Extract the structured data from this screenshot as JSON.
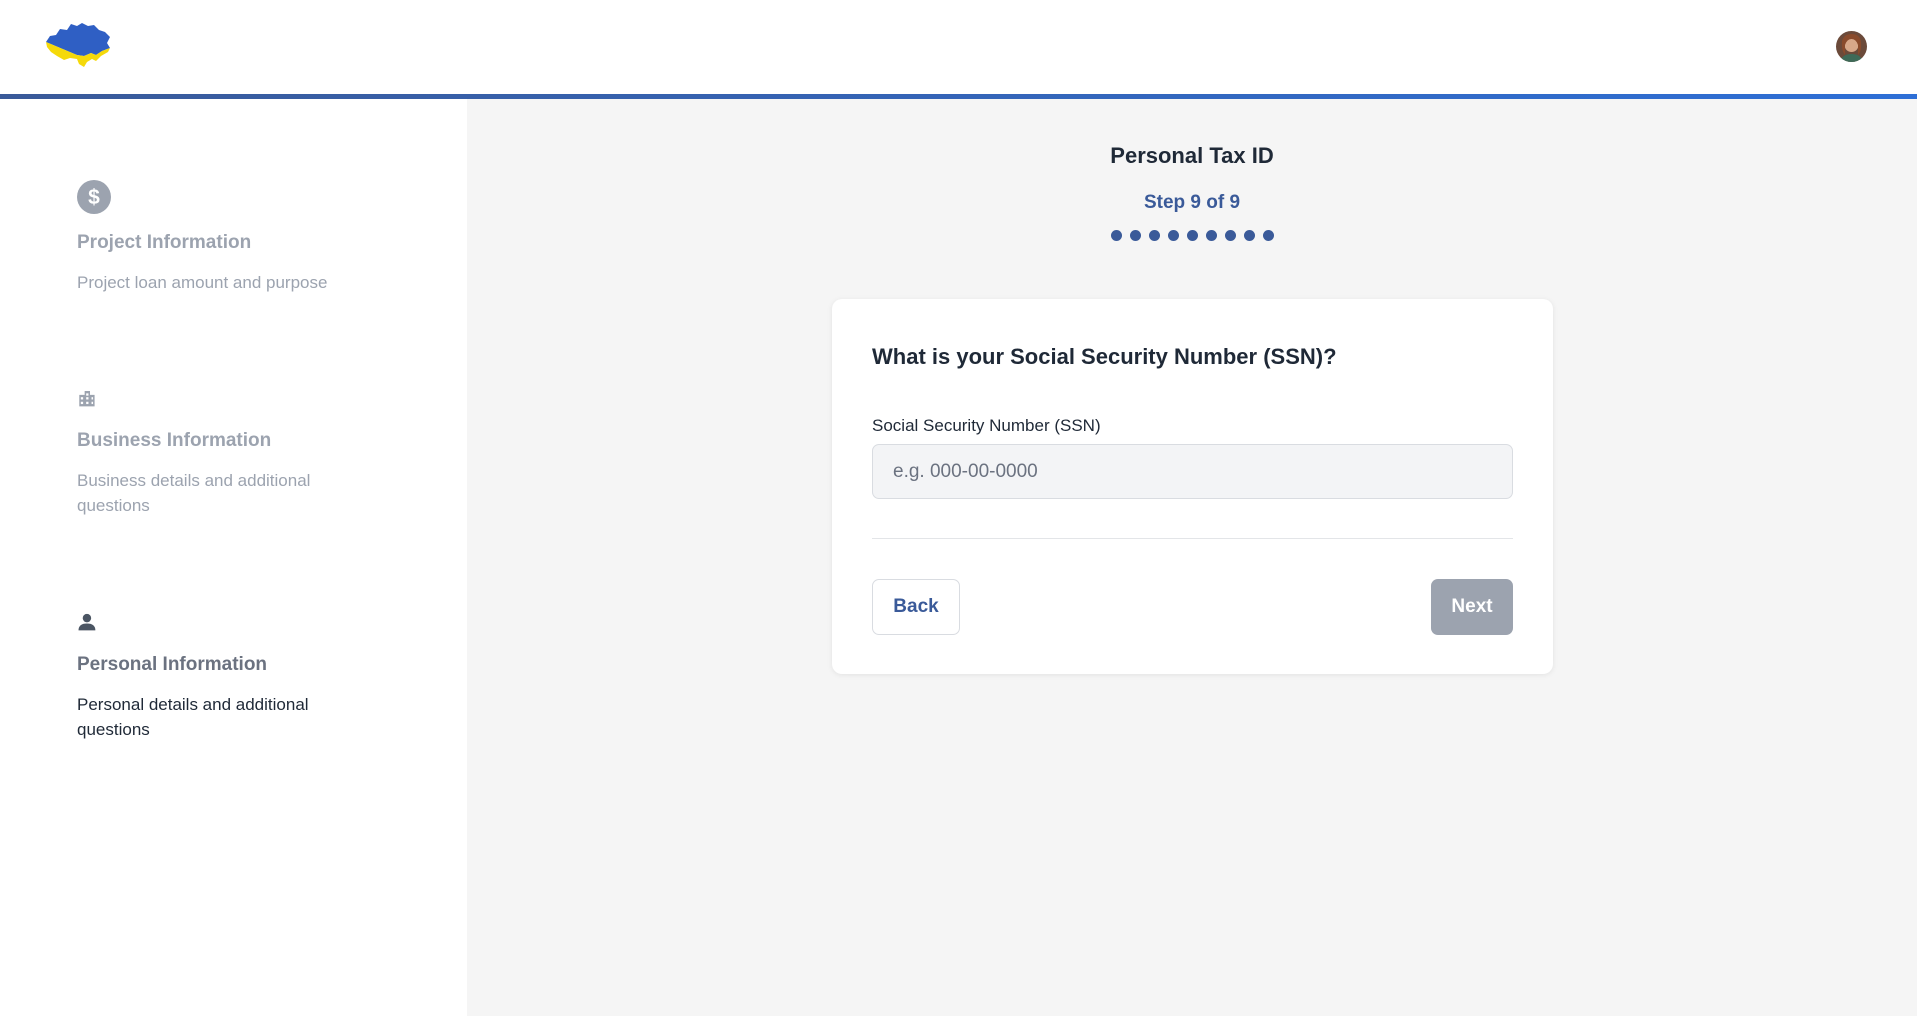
{
  "header": {
    "logo_icon": "ukraine-map-logo",
    "avatar_icon": "user-avatar"
  },
  "sidebar": {
    "items": [
      {
        "icon": "dollar-circle-icon",
        "title": "Project Information",
        "description": "Project loan amount and purpose",
        "state": "inactive"
      },
      {
        "icon": "building-icon",
        "title": "Business Information",
        "description": "Business details and additional questions",
        "state": "inactive"
      },
      {
        "icon": "person-icon",
        "title": "Personal Information",
        "description": "Personal details and additional questions",
        "state": "active"
      }
    ]
  },
  "main": {
    "title": "Personal Tax ID",
    "step_label": "Step 9 of 9",
    "steps_total": 9,
    "steps_current": 9
  },
  "form": {
    "question": "What is your Social Security Number (SSN)?",
    "ssn_label": "Social Security Number (SSN)",
    "ssn_placeholder": "e.g. 000-00-0000",
    "ssn_value": "",
    "back_label": "Back",
    "next_label": "Next"
  },
  "colors": {
    "accent": "#3a5a99",
    "header_line": "#2e6fd6",
    "inactive_text": "#9ca3af",
    "active_title": "#6b7280",
    "disabled_button": "#9ca3af",
    "page_background": "#f5f5f5"
  }
}
